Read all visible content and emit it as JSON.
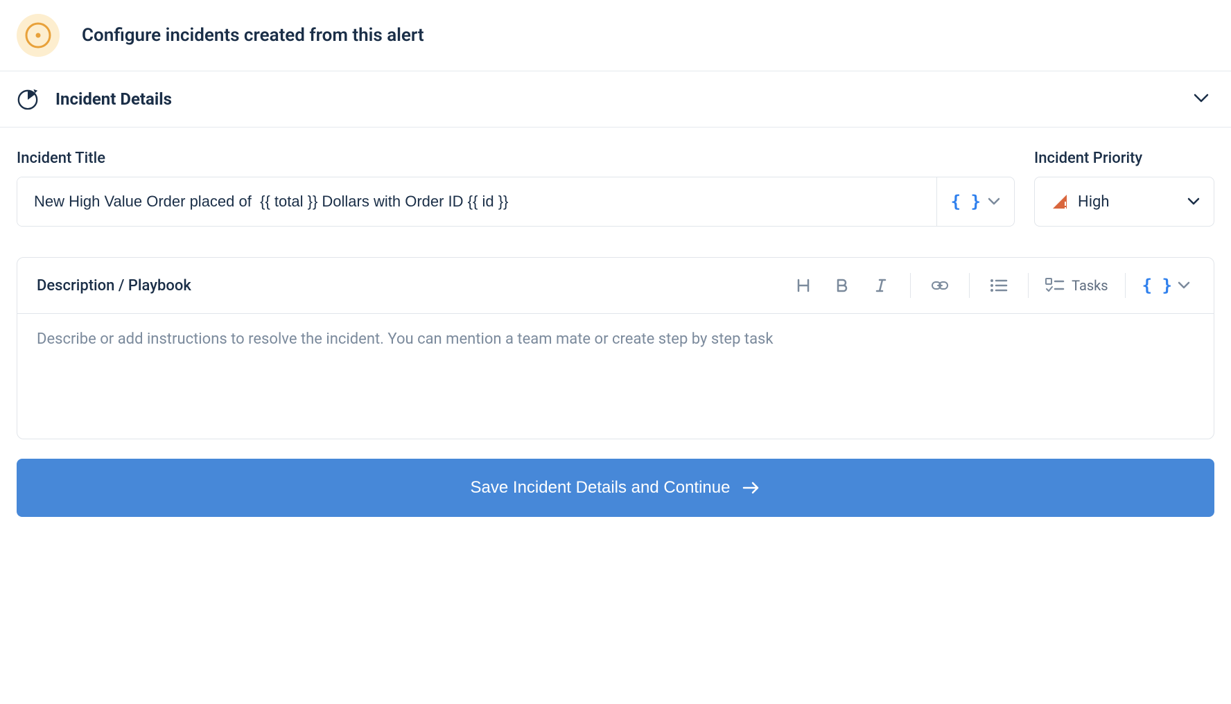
{
  "header": {
    "title": "Configure incidents created from this alert"
  },
  "section": {
    "title": "Incident Details"
  },
  "fields": {
    "incident_title": {
      "label": "Incident Title",
      "value": "New High Value Order placed of  {{ total }} Dollars with Order ID {{ id }}"
    },
    "incident_priority": {
      "label": "Incident Priority",
      "value": "High"
    }
  },
  "editor": {
    "title": "Description / Playbook",
    "placeholder": "Describe or add instructions to resolve the incident. You can mention a team mate or create step by step task",
    "tasks_label": "Tasks"
  },
  "save_button": {
    "label": "Save Incident Details and Continue"
  }
}
